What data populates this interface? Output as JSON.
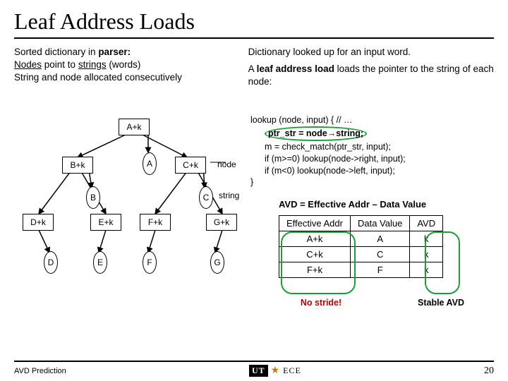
{
  "title": "Leaf Address Loads",
  "left": {
    "l1a": "Sorted dictionary in ",
    "l1b": "parser:",
    "l2a": "Nodes",
    "l2b": " point to ",
    "l2c": "strings",
    "l2d": " (words)",
    "l3": "String and node allocated consecutively"
  },
  "right": {
    "l1": "Dictionary looked up for an input word.",
    "l2a": "A ",
    "l2b": "leaf address load",
    "l2c": " loads the pointer to the string of each node:"
  },
  "code": {
    "l1": "lookup (node, input) {    // …",
    "ptr": "ptr_str = node→string;",
    "l2": "m = check_match(ptr_str, input);",
    "l3": "if (m>=0) lookup(node->right, input);",
    "l4": "if (m<0) lookup(node->left, input);",
    "l5": "}"
  },
  "avd_def": "AVD = Effective Addr – Data Value",
  "diagram": {
    "Ak": "A+k",
    "Bk": "B+k",
    "Ck": "C+k",
    "Dk": "D+k",
    "Ek": "E+k",
    "Fk": "F+k",
    "Gk": "G+k",
    "A": "A",
    "B": "B",
    "C": "C",
    "D": "D",
    "E": "E",
    "F": "F",
    "G": "G",
    "node_lbl": "node",
    "string_lbl": "string"
  },
  "table": {
    "h1": "Effective Addr",
    "h2": "Data Value",
    "h3": "AVD",
    "r1c1": "A+k",
    "r1c2": "A",
    "r1c3": "k",
    "r2c1": "C+k",
    "r2c2": "C",
    "r2c3": "k",
    "r3c1": "F+k",
    "r3c2": "F",
    "r3c3": "k"
  },
  "caption": {
    "left": "No stride!",
    "right": "Stable AVD"
  },
  "footer": {
    "left": "AVD Prediction",
    "logo_a": "UT",
    "logo_b": "ECE",
    "page": "20"
  },
  "chart_data": {
    "type": "table",
    "title": "AVD = Effective Addr – Data Value",
    "columns": [
      "Effective Addr",
      "Data Value",
      "AVD"
    ],
    "rows": [
      [
        "A+k",
        "A",
        "k"
      ],
      [
        "C+k",
        "C",
        "k"
      ],
      [
        "F+k",
        "F",
        "k"
      ]
    ],
    "annotations": {
      "Effective Addr": "No stride!",
      "AVD": "Stable AVD"
    }
  }
}
